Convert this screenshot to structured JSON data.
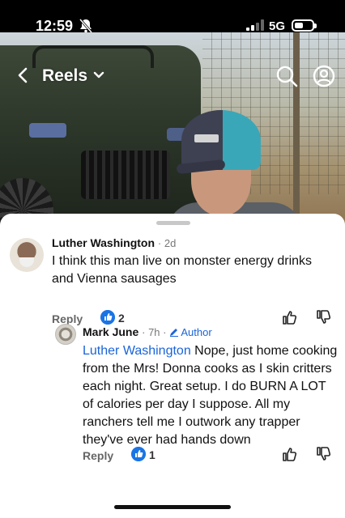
{
  "status_bar": {
    "time": "12:59",
    "network": "5G",
    "icons": [
      "bell-slash-icon",
      "signal-icon",
      "battery-icon"
    ]
  },
  "header": {
    "title": "Reels",
    "icons": [
      "back-arrow-icon",
      "chevron-down-icon",
      "search-icon",
      "profile-icon"
    ]
  },
  "comments": [
    {
      "author": "Luther Washington",
      "age": "· 2d",
      "text": "I think this man live on monster energy drinks and Vienna sausages",
      "reply_label": "Reply",
      "likes": "2"
    },
    {
      "author": "Mark June",
      "age": "· 7h ·",
      "badge": "Author",
      "mention": "Luther Washington",
      "text": "Nope, just home cooking from the Mrs! Donna cooks as I skin critters each night. Great setup. I do BURN A LOT of calories per day I suppose. All my ranchers tell me I outwork any trapper they've ever had hands down",
      "reply_label": "Reply",
      "likes": "1"
    }
  ],
  "colors": {
    "accent_blue": "#1a64d8",
    "like_badge": "#1b74e4"
  }
}
